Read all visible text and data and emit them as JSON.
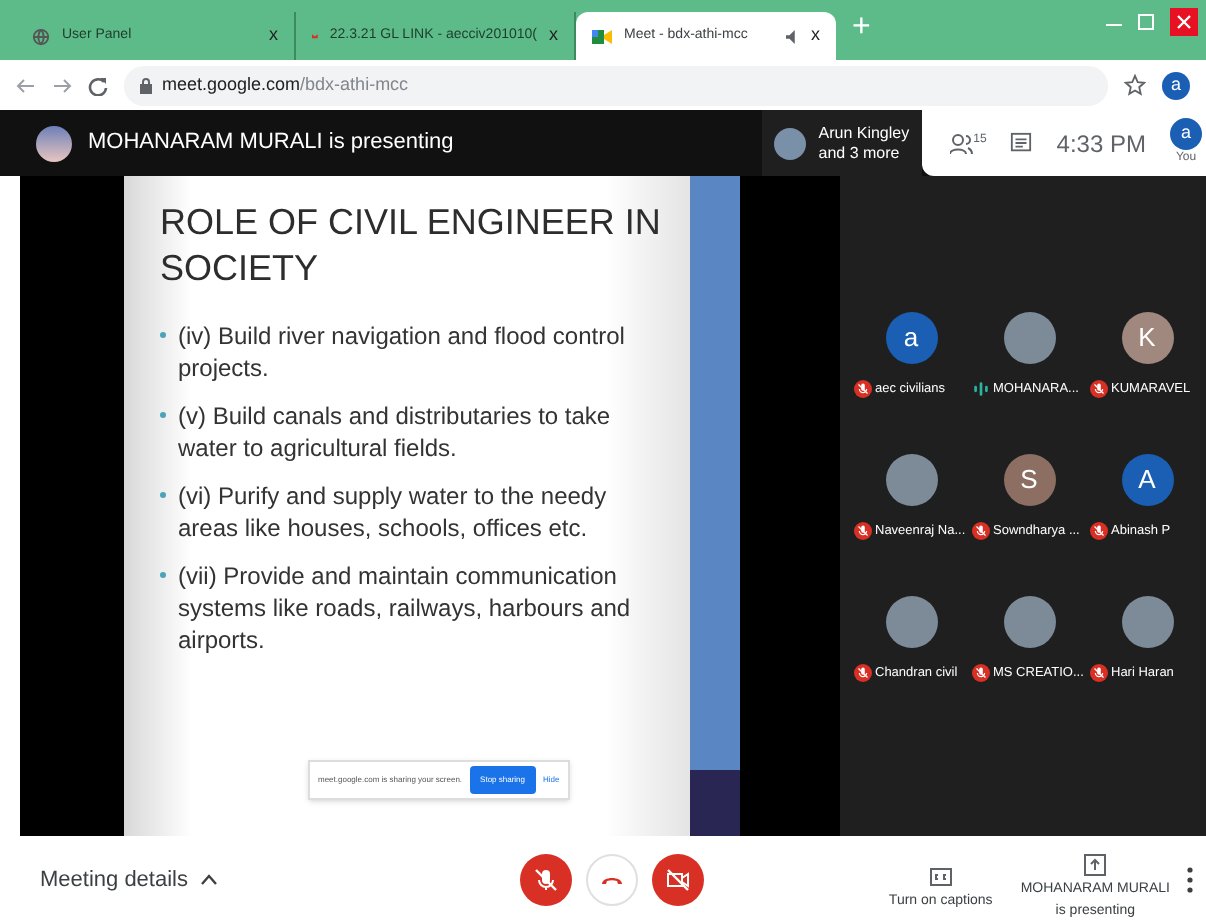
{
  "browser_tabs": [
    {
      "title": "User Panel",
      "selected": false,
      "close": "x"
    },
    {
      "title": "22.3.21 GL LINK - aecciv201010(",
      "selected": false,
      "close": "x"
    },
    {
      "title": "Meet - bdx-athi-mcc",
      "selected": true,
      "close": "x"
    }
  ],
  "new_tab": "+",
  "address": {
    "domain": "meet.google.com",
    "path": "/bdx-athi-mcc"
  },
  "profile_letter": "a",
  "header": {
    "presenting": "MOHANARAM MURALI is presenting",
    "people_line1": "Arun Kingley",
    "people_line2": "and 3 more",
    "participant_count": "15",
    "time": "4:33 PM",
    "you_letter": "a",
    "you_label": "You"
  },
  "slide": {
    "title": "ROLE OF CIVIL ENGINEER IN SOCIETY",
    "bullets": [
      "(iv) Build river navigation and flood control projects.",
      "(v) Build canals and distributaries to take water to agricultural fields.",
      "(vi) Purify and supply water to the needy areas like houses, schools, offices etc.",
      "(vii) Provide and maintain communication systems like roads, railways, harbours and airports."
    ]
  },
  "share_notice": {
    "text": "meet.google.com is sharing your screen.",
    "stop": "Stop sharing",
    "hide": "Hide"
  },
  "participants": [
    {
      "name": "aec civilians",
      "muted": true,
      "kind": "letter",
      "letter": "a",
      "color": "#1a5fb4"
    },
    {
      "name": "MOHANARA...",
      "muted": false,
      "kind": "photo"
    },
    {
      "name": "KUMARAVEL",
      "muted": true,
      "kind": "letter",
      "letter": "K",
      "color": "#a1887f"
    },
    {
      "name": "Naveenraj Na...",
      "muted": true,
      "kind": "photo"
    },
    {
      "name": "Sowndharya ...",
      "muted": true,
      "kind": "letter",
      "letter": "S",
      "color": "#8d6e63"
    },
    {
      "name": "Abinash P",
      "muted": true,
      "kind": "letter",
      "letter": "A",
      "color": "#1a5fb4"
    },
    {
      "name": "Chandran civil",
      "muted": true,
      "kind": "photo"
    },
    {
      "name": "MS CREATIO...",
      "muted": true,
      "kind": "photo"
    },
    {
      "name": "Hari Haran",
      "muted": true,
      "kind": "photo"
    }
  ],
  "footer": {
    "meeting_details": "Meeting details",
    "mic_muted": true,
    "camera_off": true,
    "captions": "Turn on captions",
    "presenter_name": "MOHANARAM MURALI",
    "presenter_status": "is presenting"
  }
}
